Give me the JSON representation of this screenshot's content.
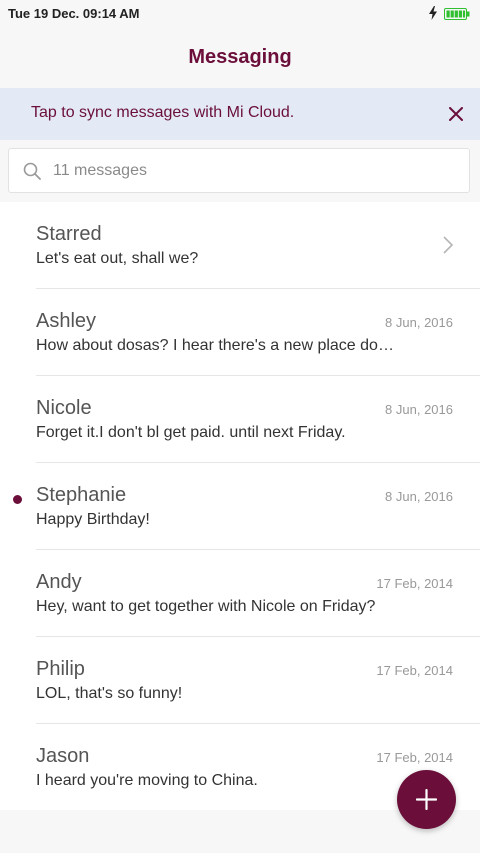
{
  "status_bar": {
    "time": "Tue 19 Dec. 09:14 AM",
    "icons": [
      "charging-icon",
      "battery-icon"
    ]
  },
  "header": {
    "title": "Messaging"
  },
  "sync_banner": {
    "text": "Tap to sync messages with Mi Cloud.",
    "close_icon": "close-icon"
  },
  "search": {
    "placeholder": "11 messages",
    "value": "",
    "icon": "search-icon"
  },
  "threads": [
    {
      "name": "Starred",
      "preview": "Let's eat out, shall we?",
      "date": "",
      "unread": false,
      "chevron": true
    },
    {
      "name": "Ashley",
      "preview": "How about dosas? I hear there's a new place down the street.",
      "date": "8 Jun, 2016",
      "unread": false
    },
    {
      "name": "Nicole",
      "preview": "Forget it.I don't bl get paid. until next Friday.",
      "date": "8 Jun, 2016",
      "unread": false
    },
    {
      "name": "Stephanie",
      "preview": "Happy Birthday!",
      "date": "8 Jun, 2016",
      "unread": true
    },
    {
      "name": "Andy",
      "preview": "Hey, want to get together with Nicole on Friday?",
      "date": "17 Feb, 2014",
      "unread": false
    },
    {
      "name": "Philip",
      "preview": "LOL, that's so funny!",
      "date": "17 Feb, 2014",
      "unread": false
    },
    {
      "name": "Jason",
      "preview": "I heard you're moving to China.",
      "date": "17 Feb, 2014",
      "unread": false
    }
  ],
  "fab": {
    "icon": "plus-icon"
  },
  "colors": {
    "accent": "#6b0f3a",
    "banner_bg": "#e3eaf5",
    "battery": "#2fbf2f"
  }
}
